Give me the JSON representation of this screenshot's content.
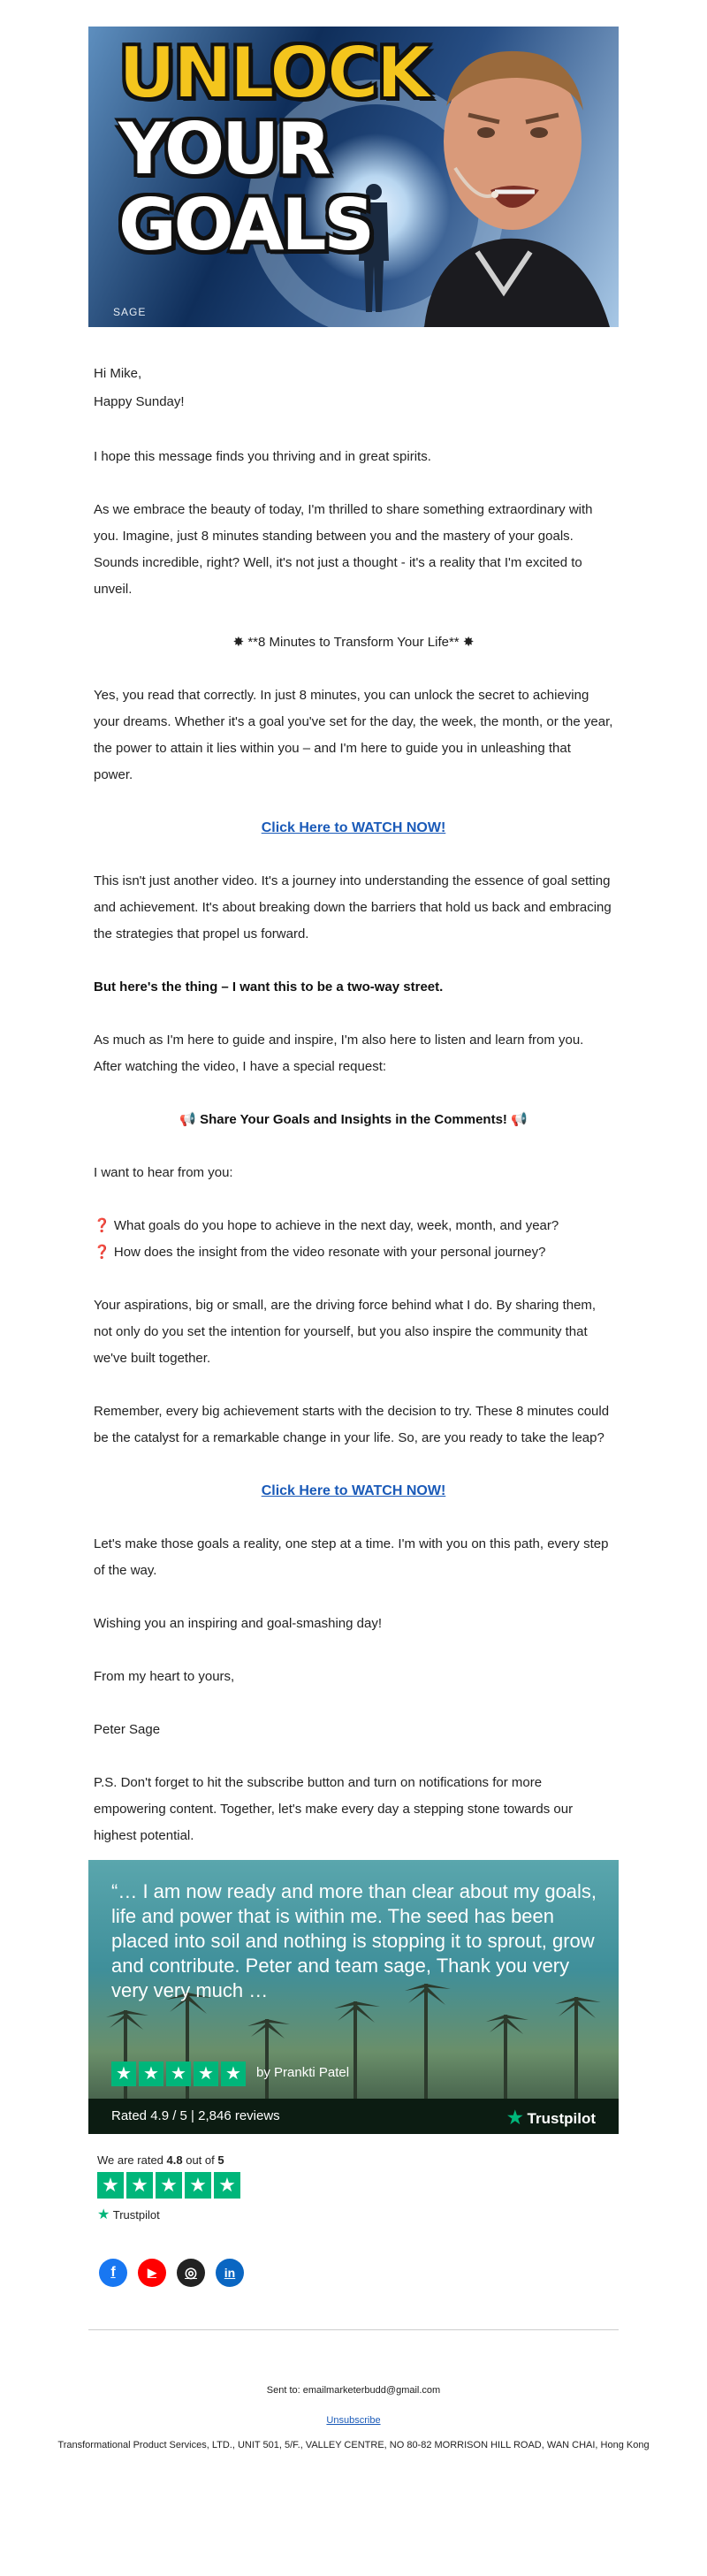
{
  "hero": {
    "title_line1": "UNLOCK",
    "title_line2": "YOUR",
    "title_line3": "GOALS",
    "brand": "SAGE"
  },
  "email": {
    "greeting": "Hi Mike,",
    "salutation": "Happy Sunday!",
    "intro": "I hope this message finds you thriving and in great spirits.",
    "para1": "As we embrace the beauty of today, I'm thrilled to share something extraordinary with you. Imagine, just 8 minutes standing between you and the mastery of your goals. Sounds incredible, right? Well, it's not just a thought - it's a reality that I'm excited to unveil.",
    "headline": "**8 Minutes to Transform Your Life**",
    "para2": "Yes, you read that correctly. In just 8 minutes, you can unlock the secret to achieving your dreams. Whether it's a goal you've set for the day, the week, the month, or the year, the power to attain it lies within you – and I'm here to guide you in unleashing that power.",
    "cta1": "Click Here to WATCH NOW!",
    "para3": "This isn't just another video. It's a journey into understanding the essence of goal setting and achievement. It's about breaking down the barriers that hold us back and embracing the strategies that propel us forward.",
    "bold_line": "But here's the thing – I want this to be a two-way street.",
    "para4": "As much as I'm here to guide and inspire, I'm also here to listen and learn from you. After watching the video, I have a special request:",
    "share_heading": "Share Your Goals and Insights in the Comments!",
    "want_hear": "I want to hear from you:",
    "question1": "What goals do you hope to achieve in the next day, week, month, and year?",
    "question2": "How does the insight from the video resonate with your personal journey?",
    "para5": "Your aspirations, big or small, are the driving force behind what I do. By sharing them, not only do you set the intention for yourself, but you also inspire the community that we've built together.",
    "para6": "Remember, every big achievement starts with the decision to try. These 8 minutes could be the catalyst for a remarkable change in your life. So, are you ready to take the leap?",
    "cta2": "Click Here to WATCH NOW!",
    "para7": "Let's make those goals a reality, one step at a time. I'm with you on this path, every step of the way.",
    "para8": "Wishing you an inspiring and goal-smashing day!",
    "signoff": "From my heart to yours,",
    "signature": "Peter Sage",
    "ps": "P.S. Don't forget to hit the subscribe button and turn on notifications for more empowering content. Together, let's make every day a stepping stone towards our highest potential."
  },
  "testimonial": {
    "quote": "“… I am now ready and more than clear about my goals, life and power that is within me. The seed has been placed into soil and nothing is stopping it to sprout, grow and contribute. Peter and team sage, Thank you very very very much …",
    "author": "by Prankti Patel",
    "rated": "Rated 4.9 / 5 | 2,846 reviews",
    "brand": "Trustpilot"
  },
  "rating": {
    "prefix": "We are rated ",
    "score": "4.8",
    "middle": " out of ",
    "max": "5",
    "brand": "Trustpilot"
  },
  "social": [
    {
      "name": "facebook",
      "glyph": "f",
      "color": "#1877f2"
    },
    {
      "name": "youtube",
      "glyph": "▶",
      "color": "#ff0000"
    },
    {
      "name": "instagram",
      "glyph": "◎",
      "color": "#222222"
    },
    {
      "name": "linkedin",
      "glyph": "in",
      "color": "#0a66c2"
    }
  ],
  "footer": {
    "sent_to": "Sent to: emailmarketerbudd@gmail.com",
    "unsubscribe": "Unsubscribe",
    "address": "Transformational Product Services, LTD., UNIT 501, 5/F., VALLEY CENTRE, NO 80-82 MORRISON HILL ROAD, WAN CHAI, Hong Kong"
  },
  "colors": {
    "link": "#1a5ab8",
    "trustpilot_green": "#00b67a"
  }
}
